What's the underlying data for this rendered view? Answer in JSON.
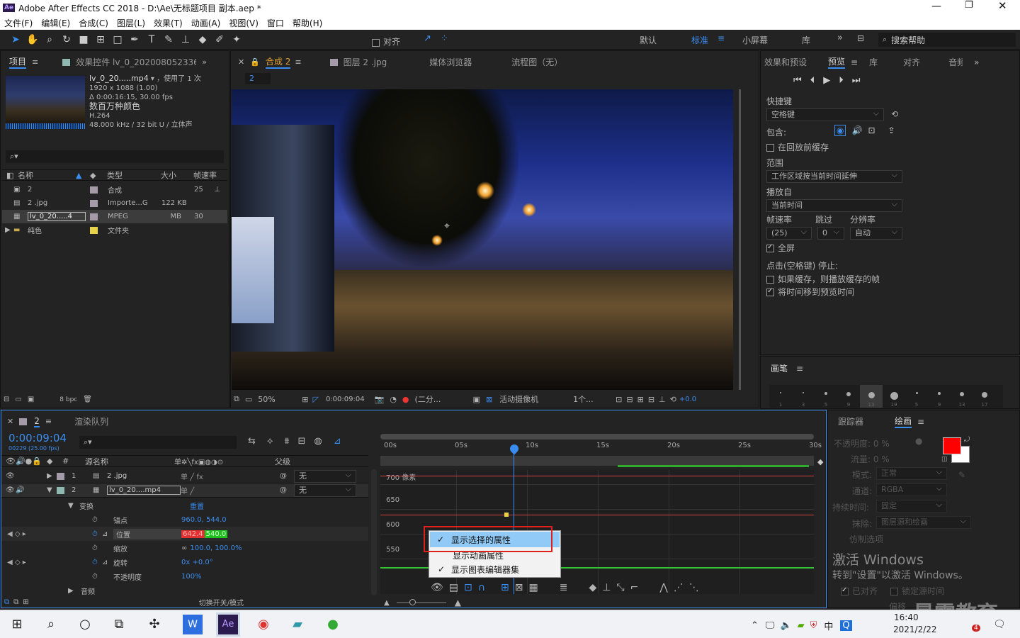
{
  "titlebar": {
    "title": "Adobe After Effects CC 2018 - D:\\Ae\\无标题项目 副本.aep *",
    "app_icon": "Ae"
  },
  "menu": [
    "文件(F)",
    "编辑(E)",
    "合成(C)",
    "图层(L)",
    "效果(T)",
    "动画(A)",
    "视图(V)",
    "窗口",
    "帮助(H)"
  ],
  "toolbar": {
    "align_label": "对齐",
    "workspaces": [
      "默认",
      "标准",
      "小屏幕",
      "库"
    ],
    "search_placeholder": "搜索帮助"
  },
  "project": {
    "tabs": [
      "项目",
      "效果控件 lv_0_2020080523360"
    ],
    "file": {
      "name": "lv_0_20.....mp4",
      "used": "，使用了 1 次",
      "dims": "1920 x 1088 (1.00)",
      "duration": "Δ 0:00:16:15, 30.00 fps",
      "colors": "数百万种颜色",
      "codec": "H.264",
      "audio": "48.000 kHz / 32 bit U / 立体声"
    },
    "columns": [
      "名称",
      "类型",
      "大小",
      "帧速率"
    ],
    "rows": [
      {
        "name": "2",
        "type": "合成",
        "size": "",
        "fps": "25",
        "color": "#a59ba8"
      },
      {
        "name": "2 .jpg",
        "type": "Importe...G",
        "size": "122 KB",
        "fps": "",
        "color": "#a59ba8"
      },
      {
        "name": "lv_0_20.....4",
        "type": "MPEG",
        "size": "MB",
        "fps": "30",
        "color": "#a59ba8"
      },
      {
        "name": "纯色",
        "type": "文件夹",
        "size": "",
        "fps": "",
        "color": "#e8d24a"
      }
    ],
    "bpc": "8 bpc"
  },
  "composition": {
    "tabs": [
      "合成 2",
      "图层 2 .jpg",
      "媒体浏览器",
      "流程图（无）"
    ],
    "subtab": "2",
    "footer": {
      "zoom": "50%",
      "time": "0:00:09:04",
      "quality": "(二分...",
      "camera": "活动摄像机",
      "views": "1个...",
      "exposure": "+0.0"
    }
  },
  "preview": {
    "tabs": [
      "效果和预设",
      "预览",
      "库",
      "对齐",
      "音频"
    ],
    "shortcut_label": "快捷键",
    "shortcut_value": "空格键",
    "include_label": "包含:",
    "cache_before": "在回放前缓存",
    "range_label": "范围",
    "range_value": "工作区域按当前时间延伸",
    "play_from_label": "播放自",
    "play_from_value": "当前时间",
    "fps_label": "帧速率",
    "skip_label": "跳过",
    "res_label": "分辨率",
    "fps_value": "(25)",
    "skip_value": "0",
    "res_value": "自动",
    "fullscreen": "全屏",
    "stop_label": "点击(空格键) 停止:",
    "stop_opt1": "如果缓存，则播放缓存的帧",
    "stop_opt2": "将时间移到预览时间"
  },
  "brushes": {
    "title": "画笔",
    "sizes": [
      "1",
      "3",
      "5",
      "9",
      "13",
      "19",
      "5",
      "9",
      "13",
      "17"
    ]
  },
  "timeline": {
    "tabs": [
      "2",
      "渲染队列"
    ],
    "timecode": "0:00:09:04",
    "frames": "00229 (25.00 fps)",
    "col_source": "源名称",
    "col_parent": "父级",
    "col_num": "#",
    "layers": [
      {
        "num": "1",
        "name": "2 .jpg",
        "parent": "无",
        "color": "#a59ba8"
      },
      {
        "num": "2",
        "name": "lv_0_20....mp4",
        "parent": "无",
        "color": "#8fb8b0"
      }
    ],
    "transform": "变换",
    "reset": "重置",
    "props": [
      {
        "name": "锚点",
        "value": "960.0, 544.0"
      },
      {
        "name": "位置",
        "value_x": "642.4",
        "value_y": "540.0"
      },
      {
        "name": "缩放",
        "value": "100.0, 100.0%"
      },
      {
        "name": "旋转",
        "value": "0x +0.0°"
      },
      {
        "name": "不透明度",
        "value": "100%"
      }
    ],
    "audio": "音频",
    "switch_modes": "切换开关/模式",
    "ruler": [
      "00s",
      "05s",
      "10s",
      "15s",
      "20s",
      "25s",
      "30s"
    ],
    "graph_labels": [
      "700 像素",
      "650",
      "600",
      "550"
    ]
  },
  "context_menu": {
    "items": [
      "显示选择的属性",
      "显示动画属性",
      "显示图表编辑器集"
    ]
  },
  "tracker_panel": {
    "tabs": [
      "跟踪器",
      "绘画"
    ],
    "opacity": "不透明度: 0 %",
    "flow": "流量: 0 %",
    "mode_label": "模式:",
    "mode": "正常",
    "channel_label": "通道:",
    "channel": "RGBA",
    "duration_label": "持续时间:",
    "duration": "固定",
    "erase_label": "抹除:",
    "erase": "图层源和绘画",
    "clone": "仿制选项",
    "aligned": "已对齐",
    "lock_time": "锁定源时间",
    "offset": "偏移",
    "fg": "#ff0000",
    "bg": "#ffffff"
  },
  "watermark": {
    "line1": "激活 Windows",
    "line2": "转到\"设置\"以激活 Windows。",
    "brand": "最需教育"
  },
  "taskbar": {
    "time": "16:40",
    "date": "2021/2/22",
    "ime": "中",
    "badge": "4"
  }
}
